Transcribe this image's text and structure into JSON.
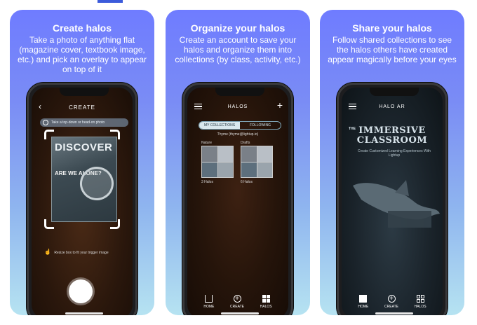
{
  "panels": [
    {
      "title": "Create halos",
      "description": "Take a photo of anything flat (magazine cover, textbook image, etc.) and pick an overlay to appear on top of it",
      "screen": {
        "header": "CREATE",
        "hint": "Take a top-down or head-on photo",
        "magazine_title": "DISCOVER",
        "magazine_headline": "ARE WE ALONE?",
        "resize_hint": "Resize box to fit your trigger image"
      }
    },
    {
      "title": "Organize your halos",
      "description": "Create an account to save your halos and organize them into collections (by class, activity, etc.)",
      "screen": {
        "header": "HALOS",
        "tabs": [
          "MY COLLECTIONS",
          "FOLLOWING"
        ],
        "user": "Thyme (thyme@lightup.io)",
        "collections": [
          {
            "name": "Nature",
            "count": "3 Halos"
          },
          {
            "name": "Drafts",
            "count": "6 Halos"
          }
        ],
        "tabbar": [
          "HOME",
          "CREATE",
          "HALOS"
        ]
      }
    },
    {
      "title": "Share your halos",
      "description": "Follow shared collections to see the halos others have created appear magically before your eyes",
      "screen": {
        "header": "HALO AR",
        "overlay_the": "THE",
        "overlay_title_line1": "IMMERSIVE",
        "overlay_title_line2": "CLASSROOM",
        "overlay_subtitle": "Create Customized Learning Experiences With Lightup",
        "tabbar": [
          "HOME",
          "CREATE",
          "HALOS"
        ]
      }
    }
  ],
  "colors": {
    "panel_gradient_top": "#6f7cff",
    "panel_gradient_bottom": "#b6e3f1",
    "accent_mark": "#3b5bdb"
  }
}
